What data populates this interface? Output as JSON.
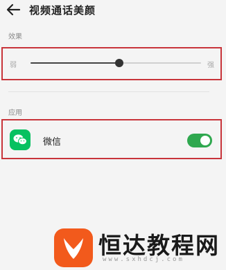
{
  "header": {
    "title": "视频通话美颜",
    "back_icon": "arrow-left-icon"
  },
  "effect_section": {
    "label": "效果",
    "slider": {
      "min_label": "弱",
      "max_label": "强",
      "value": 0.52
    }
  },
  "apps_section": {
    "label": "应用",
    "items": [
      {
        "name": "微信",
        "icon": "wechat-icon",
        "enabled": true
      }
    ]
  },
  "colors": {
    "highlight_border": "#c8343a",
    "toggle_on": "#2fa84f",
    "wechat_green": "#07c160",
    "watermark_orange": "#f25a1c"
  },
  "watermark": {
    "brand": "恒达教程网",
    "url": "www.sxhdcj.com"
  }
}
